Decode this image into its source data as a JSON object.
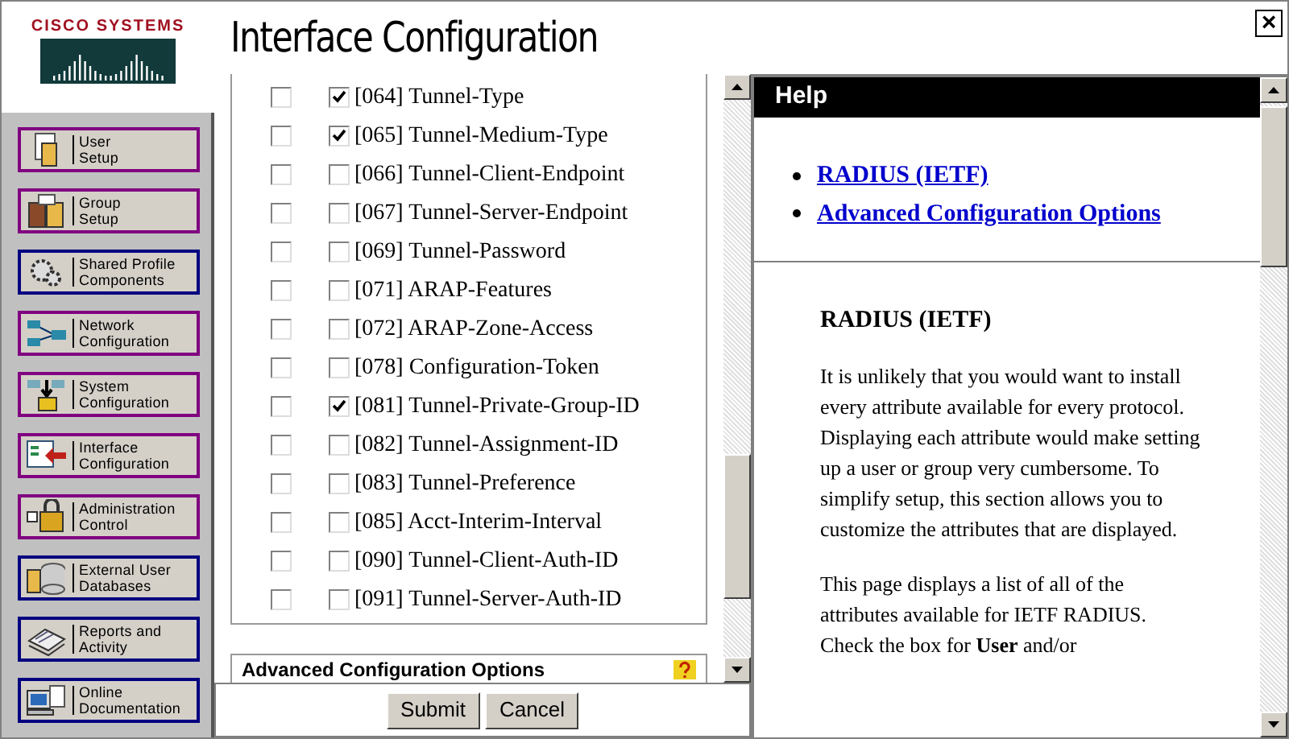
{
  "logo": {
    "text": "CISCO SYSTEMS"
  },
  "title": "Interface Configuration",
  "close": "×",
  "nav": [
    {
      "lines": [
        "User",
        "Setup"
      ],
      "color": "#800080",
      "kind": "user"
    },
    {
      "lines": [
        "Group",
        "Setup"
      ],
      "color": "#800080",
      "kind": "group"
    },
    {
      "lines": [
        "Shared Profile",
        "Components"
      ],
      "color": "#000080",
      "kind": "gear"
    },
    {
      "lines": [
        "Network",
        "Configuration"
      ],
      "color": "#800080",
      "kind": "network"
    },
    {
      "lines": [
        "System",
        "Configuration"
      ],
      "color": "#800080",
      "kind": "system"
    },
    {
      "lines": [
        "Interface",
        "Configuration"
      ],
      "color": "#800080",
      "kind": "interface"
    },
    {
      "lines": [
        "Administration",
        "Control"
      ],
      "color": "#800080",
      "kind": "lock"
    },
    {
      "lines": [
        "External User",
        "Databases"
      ],
      "color": "#000080",
      "kind": "database"
    },
    {
      "lines": [
        "Reports and",
        "Activity"
      ],
      "color": "#000080",
      "kind": "reports"
    },
    {
      "lines": [
        "Online",
        "Documentation"
      ],
      "color": "#000080",
      "kind": "docs"
    }
  ],
  "attributes": [
    {
      "user_checked": false,
      "group_checked": true,
      "label": "[064] Tunnel-Type"
    },
    {
      "user_checked": false,
      "group_checked": true,
      "label": "[065] Tunnel-Medium-Type"
    },
    {
      "user_checked": false,
      "group_checked": false,
      "label": "[066] Tunnel-Client-Endpoint"
    },
    {
      "user_checked": false,
      "group_checked": false,
      "label": "[067] Tunnel-Server-Endpoint"
    },
    {
      "user_checked": false,
      "group_checked": false,
      "label": "[069] Tunnel-Password"
    },
    {
      "user_checked": false,
      "group_checked": false,
      "label": "[071] ARAP-Features"
    },
    {
      "user_checked": false,
      "group_checked": false,
      "label": "[072] ARAP-Zone-Access"
    },
    {
      "user_checked": false,
      "group_checked": false,
      "label": "[078] Configuration-Token"
    },
    {
      "user_checked": false,
      "group_checked": true,
      "label": "[081] Tunnel-Private-Group-ID"
    },
    {
      "user_checked": false,
      "group_checked": false,
      "label": "[082] Tunnel-Assignment-ID"
    },
    {
      "user_checked": false,
      "group_checked": false,
      "label": "[083] Tunnel-Preference"
    },
    {
      "user_checked": false,
      "group_checked": false,
      "label": "[085] Acct-Interim-Interval"
    },
    {
      "user_checked": false,
      "group_checked": false,
      "label": "[090] Tunnel-Client-Auth-ID"
    },
    {
      "user_checked": false,
      "group_checked": false,
      "label": "[091] Tunnel-Server-Auth-ID"
    }
  ],
  "advanced_section": {
    "title": "Advanced Configuration Options"
  },
  "buttons": [
    "Submit",
    "Cancel"
  ],
  "help": {
    "title": "Help",
    "links": [
      "RADIUS (IETF)",
      "Advanced Configuration Options"
    ],
    "heading": "RADIUS (IETF)",
    "paragraphs": [
      "It is unlikely that you would want to install every attribute available for every protocol. Displaying each attribute would make setting up a user or group very cumbersome. To simplify setup, this section allows you to customize the attributes that are displayed.",
      "This page displays a list of all of the attributes available for IETF RADIUS. Check the box for **User** and/or"
    ]
  }
}
